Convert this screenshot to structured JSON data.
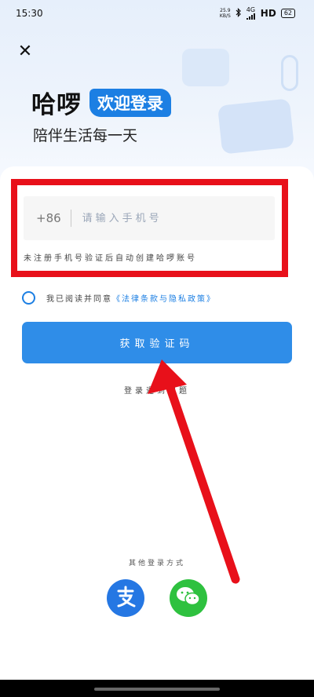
{
  "status_bar": {
    "time": "15:30",
    "net_speed_value": "25.9",
    "net_speed_unit": "KB/S",
    "signal_label": "4G",
    "hd_label": "HD",
    "battery": "62"
  },
  "header": {
    "close_icon": "close-icon",
    "brand": "哈啰",
    "welcome": "欢迎登录",
    "subtitle": "陪伴生活每一天"
  },
  "login_form": {
    "country_code": "+86",
    "phone_placeholder": "请输入手机号",
    "hint": "未注册手机号验证后自动创建哈啰账号",
    "agreement_prefix": "我已阅读并同意",
    "agreement_link": "《法律条款与隐私政策》",
    "submit_label": "获取验证码",
    "trouble_label": "登录遇到问题"
  },
  "other_login": {
    "label": "其他登录方式",
    "methods": [
      {
        "name": "alipay",
        "icon": "alipay-icon",
        "color": "#2577e3"
      },
      {
        "name": "wechat",
        "icon": "wechat-icon",
        "color": "#2ec13f"
      }
    ]
  },
  "colors": {
    "accent": "#2f8de8",
    "annotation_red": "#e8101a"
  }
}
